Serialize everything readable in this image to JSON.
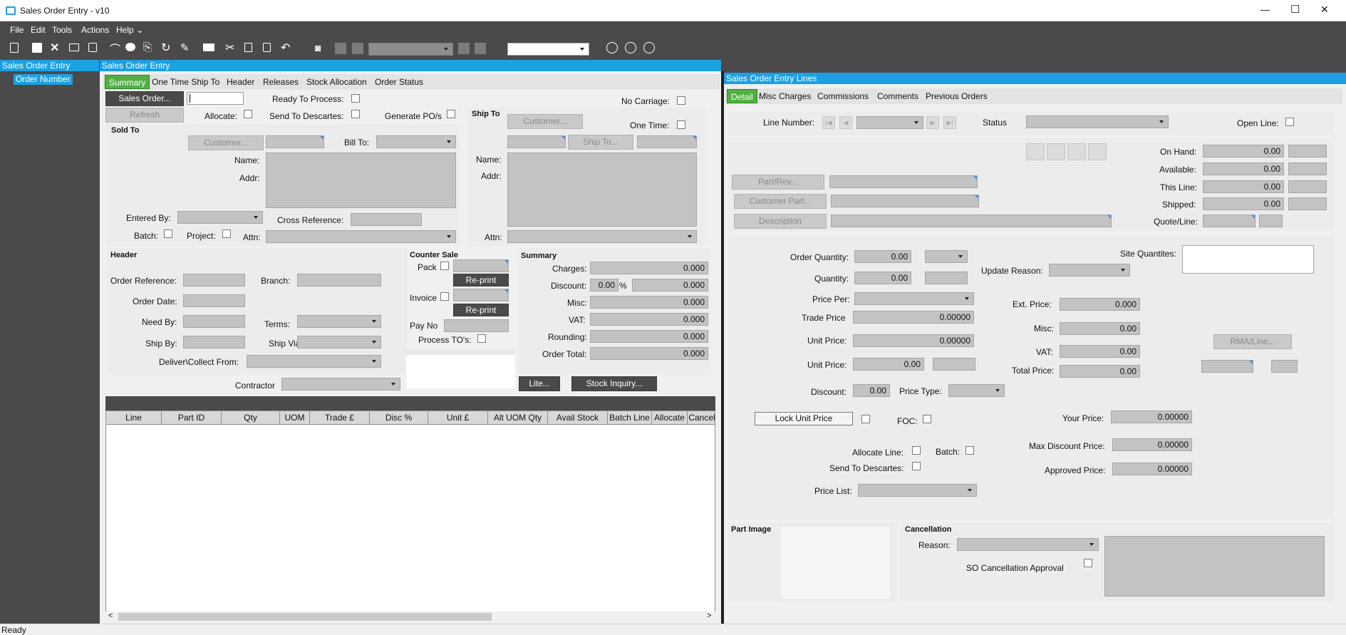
{
  "window": {
    "title": "Sales Order Entry - v10",
    "minimize": "—",
    "maximize": "☐",
    "close": "✕"
  },
  "menu": [
    "File",
    "Edit",
    "Tools",
    "Actions",
    "Help ⌄"
  ],
  "tree": {
    "header": "Sales Order Entry",
    "item": "Order Number"
  },
  "main": {
    "header": "Sales Order Entry",
    "tabs": [
      "Summary",
      "One Time Ship To",
      "Header",
      "Releases",
      "Stock Allocation",
      "Order Status"
    ],
    "sales_order_btn": "Sales Order...",
    "refresh_btn": "Refresh",
    "ready_to_process": "Ready To Process:",
    "allocate": "Allocate:",
    "send_to_descartes": "Send To Descartes:",
    "generate_pos": "Generate PO/s",
    "no_carriage": "No Carriage:",
    "sold_to": {
      "title": "Sold To",
      "customer_btn": "Customer...",
      "bill_to": "Bill To:",
      "name": "Name:",
      "addr": "Addr:",
      "entered_by": "Entered By:",
      "cross_reference": "Cross Reference:",
      "batch": "Batch:",
      "project": "Project:",
      "attn": "Attn:"
    },
    "ship_to": {
      "title": "Ship To",
      "customer_btn": "Customer...",
      "one_time": "One Time:",
      "ship_to_btn": "Ship To...",
      "name": "Name:",
      "addr": "Addr:",
      "attn": "Attn:"
    },
    "header_sec": {
      "title": "Header",
      "order_reference": "Order Reference:",
      "branch": "Branch:",
      "order_date": "Order Date:",
      "need_by": "Need By:",
      "terms": "Terms:",
      "ship_by": "Ship By:",
      "ship_via": "Ship Via:",
      "deliver_from": "Deliver\\Collect From:"
    },
    "counter_sale": {
      "title": "Counter Sale",
      "pack": "Pack",
      "reprint": "Re-print",
      "invoice": "Invoice",
      "pay_no": "Pay No",
      "process_tos": "Process TO's:"
    },
    "summary": {
      "title": "Summary",
      "charges": "Charges:",
      "charges_val": "0.000",
      "discount": "Discount:",
      "discount_pct": "0.00",
      "pct": "%",
      "discount_val": "0.000",
      "misc": "Misc:",
      "misc_val": "0.000",
      "vat": "VAT:",
      "vat_val": "0.000",
      "rounding": "Rounding:",
      "rounding_val": "0.000",
      "order_total": "Order Total:",
      "order_total_val": "0.000"
    },
    "contractor": "Contractor",
    "lite_btn": "Lite...",
    "stock_inquiry_btn": "Stock Inquiry...",
    "grid_columns": [
      "Line",
      "Part ID",
      "Qty",
      "UOM",
      "Trade £",
      "Disc %",
      "Unit £",
      "Alt UOM Qty",
      "Avail Stock",
      "Batch Line",
      "Allocate",
      "Cancel"
    ]
  },
  "lines": {
    "header": "Sales Order Entry Lines",
    "tabs": [
      "Detail",
      "Misc Charges",
      "Commissions",
      "Comments",
      "Previous Orders"
    ],
    "line_number": "Line Number:",
    "status": "Status",
    "open_line": "Open Line:",
    "on_hand": "On Hand:",
    "on_hand_val": "0.00",
    "available": "Available:",
    "available_val": "0.00",
    "this_line": "This Line:",
    "this_line_val": "0.00",
    "shipped": "Shipped:",
    "shipped_val": "0.00",
    "quote_line": "Quote/Line:",
    "part_rev_btn": "Part/Rev...",
    "customer_part_btn": "Customer Part...",
    "description_btn": "Description",
    "order_quantity": "Order Quantity:",
    "order_quantity_val": "0.00",
    "quantity": "Quantity:",
    "quantity_val": "0.00",
    "update_reason": "Update Reason:",
    "site_quantities": "Site Quantites:",
    "price_per": "Price Per:",
    "ext_price": "Ext. Price:",
    "ext_price_val": "0.000",
    "trade_price": "Trade Price",
    "trade_price_val": "0.00000",
    "misc": "Misc:",
    "misc_val": "0.00",
    "unit_price": "Unit Price:",
    "unit_price_val": "0.00000",
    "unit_price2": "Unit Price:",
    "unit_price2_val": "0.00",
    "vat": "VAT:",
    "vat_val": "0.00",
    "total_price": "Total Price:",
    "total_price_val": "0.00",
    "rma_line_btn": "RMA/Line...",
    "discount": "Discount:",
    "discount_val": "0.00",
    "price_type": "Price Type:",
    "lock_unit_price_btn": "Lock Unit Price",
    "foc": "FOC:",
    "your_price": "Your Price:",
    "your_price_val": "0.00000",
    "allocate_line": "Allocate Line:",
    "batch": "Batch:",
    "max_discount_price": "Max Discount Price:",
    "max_discount_price_val": "0.00000",
    "send_to_descartes": "Send To Descartes:",
    "approved_price": "Approved Price:",
    "approved_price_val": "0.00000",
    "price_list": "Price List:",
    "part_image": "Part Image",
    "cancellation": "Cancellation",
    "reason": "Reason:",
    "so_cancellation_approval": "SO Cancellation Approval"
  },
  "status_bar": "Ready"
}
